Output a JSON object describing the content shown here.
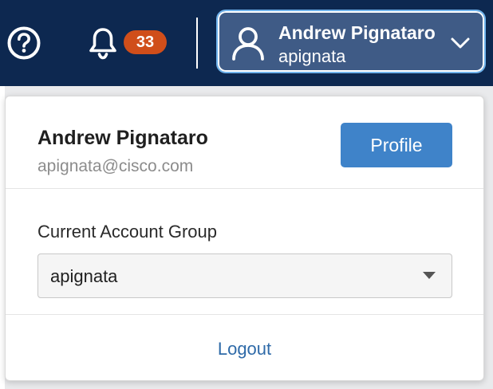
{
  "header": {
    "help_icon": "question-circle-icon",
    "notifications_icon": "bell-icon",
    "notification_count": "33",
    "user_menu": {
      "name": "Andrew Pignataro",
      "username": "apignata",
      "avatar_icon": "user-icon",
      "chevron_icon": "chevron-down-icon"
    }
  },
  "dropdown": {
    "name": "Andrew Pignataro",
    "email": "apignata@cisco.com",
    "profile_label": "Profile",
    "account_group_label": "Current Account Group",
    "account_group_value": "apignata",
    "logout_label": "Logout"
  },
  "colors": {
    "header_bg": "#0d2850",
    "badge_bg": "#d04e1a",
    "user_button_bg": "#3f5b86",
    "user_button_border": "#6fb3ec",
    "primary_button": "#3f83c9",
    "link": "#2e6aa8"
  }
}
